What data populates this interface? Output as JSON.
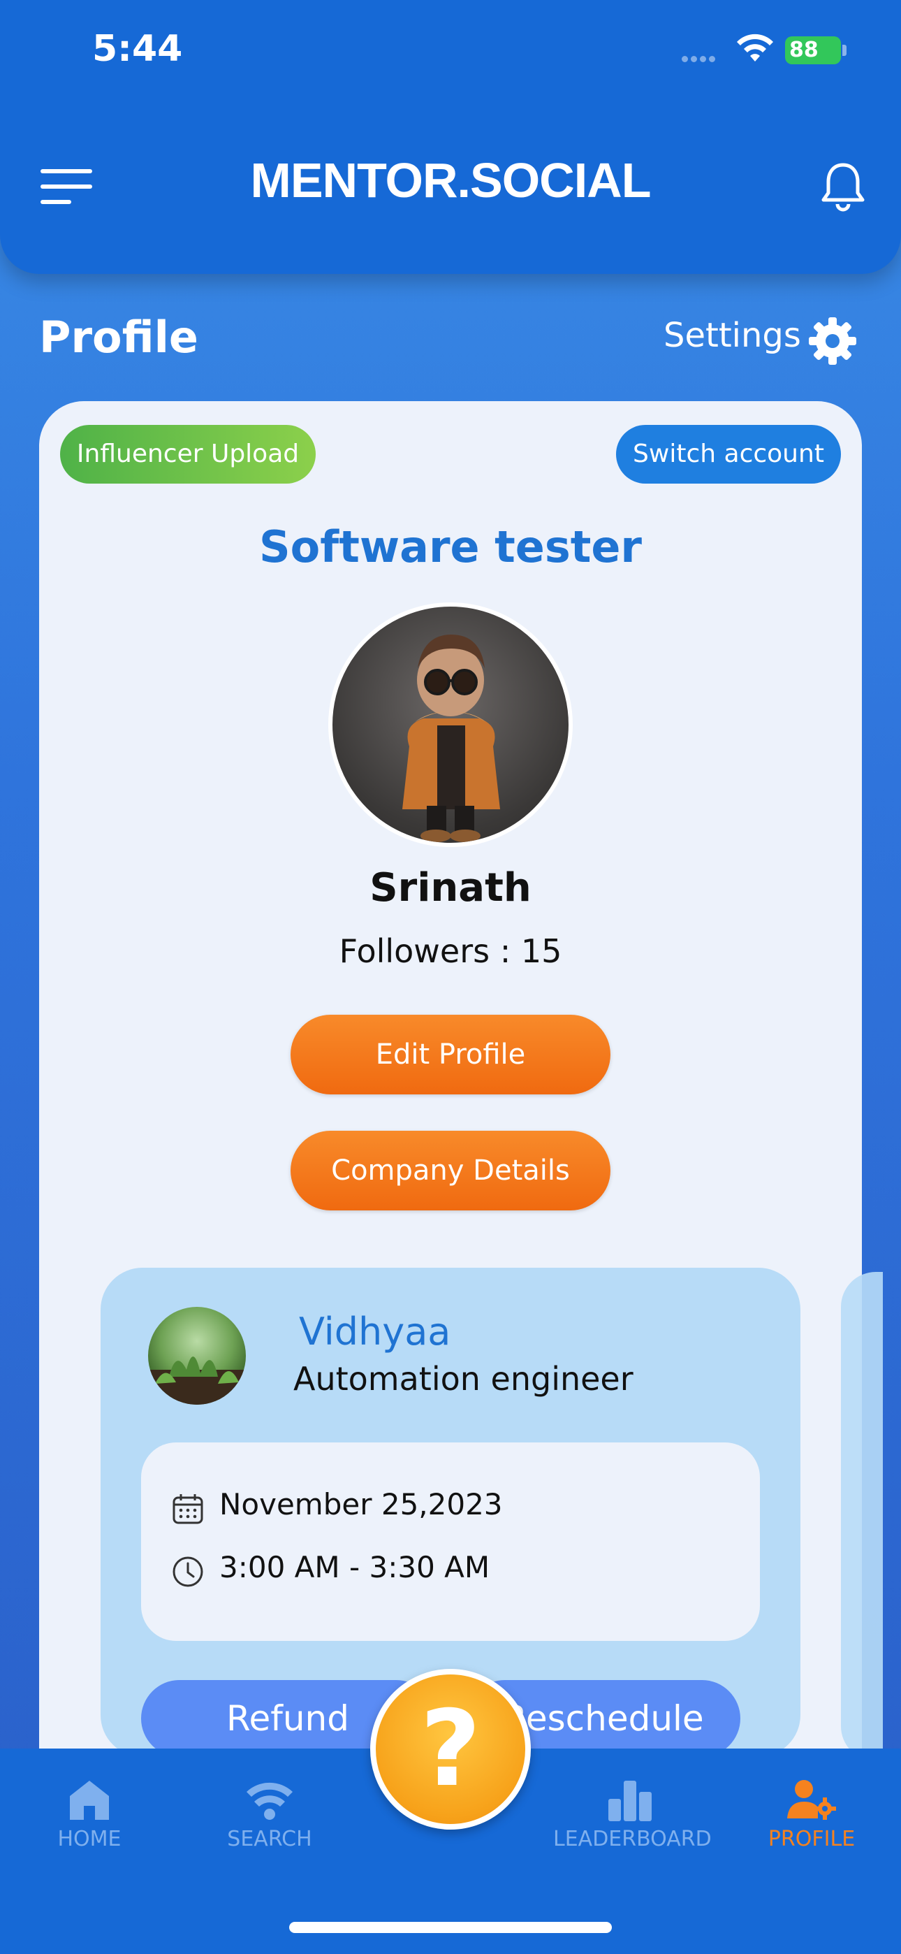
{
  "status_bar": {
    "time": "5:44",
    "battery": "88"
  },
  "header": {
    "title": "MENTOR.SOCIAL"
  },
  "page": {
    "title": "Profile",
    "settings_label": "Settings"
  },
  "profile": {
    "influencer_upload_label": "Influencer Upload",
    "switch_account_label": "Switch account",
    "role": "Software tester",
    "name": "Srinath",
    "followers": "Followers : 15",
    "edit_profile_label": "Edit Profile",
    "company_details_label": "Company Details"
  },
  "booking": {
    "mentor_name": "Vidhyaa",
    "mentor_role": "Automation engineer",
    "date": "November 25,2023",
    "time": "3:00 AM - 3:30 AM",
    "refund_label": "Refund",
    "reschedule_label": "Reschedule"
  },
  "help": {
    "label": "?"
  },
  "nav": {
    "items": [
      {
        "label": "HOME",
        "icon": "home-icon"
      },
      {
        "label": "SEARCH",
        "icon": "search-signal-icon"
      },
      {
        "label": "LEADERBOARD",
        "icon": "leaderboard-icon"
      },
      {
        "label": "PROFILE",
        "icon": "profile-settings-icon",
        "active": true
      }
    ]
  },
  "colors": {
    "brand_blue": "#1669d6",
    "accent_orange": "#f5821f",
    "title_blue": "#1f73d2",
    "green": "#4fb248"
  }
}
